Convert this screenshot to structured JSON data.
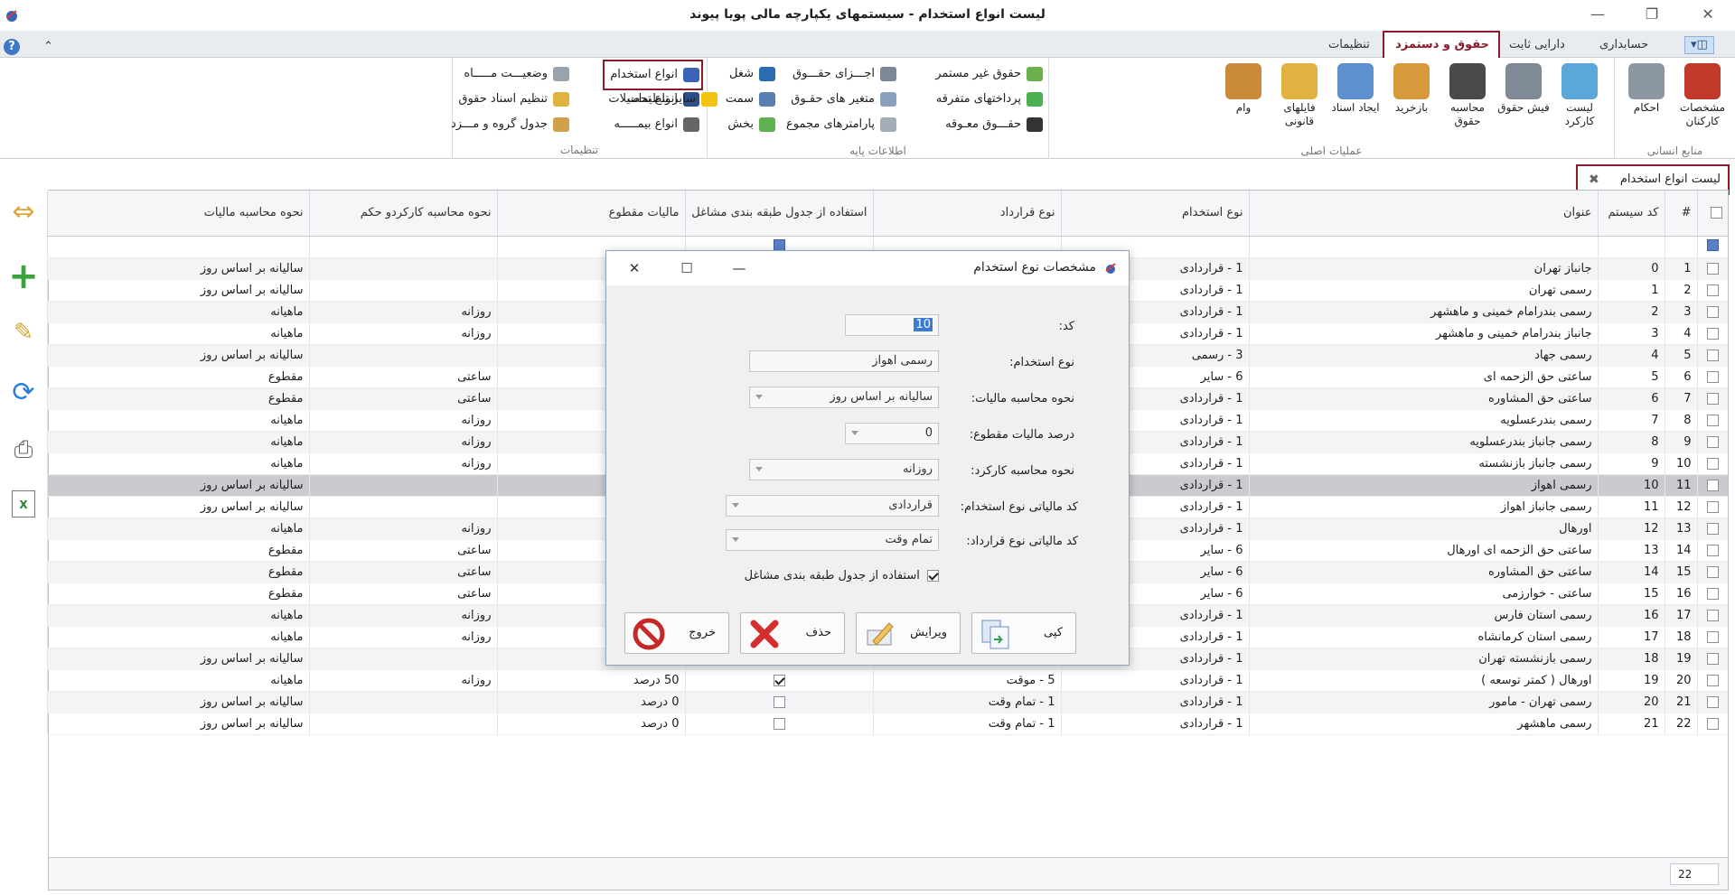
{
  "window": {
    "title": "لیست انواع استخدام - سیستمهای یکپارچه مالی پویا پیوند"
  },
  "tabs": {
    "accounting": "حسابداری",
    "fixed_assets": "دارایی ثابت",
    "payroll": "حقوق و دستمزد",
    "settings": "تنظیمات"
  },
  "ribbon": {
    "hr": {
      "label": "منابع انسانی",
      "employee_specs": "مشخصات کارکنان",
      "rulings": "احکام"
    },
    "main_ops": {
      "label": "عملیات اصلی",
      "work_list": "لیست کارکرد",
      "payslip": "فیش حقوق",
      "calc_salary": "محاسبه حقوق",
      "recalc": "بازخرید",
      "create_doc": "ایجاد اسناد",
      "legal_files": "فایلهای قانونی",
      "loan": "وام"
    },
    "base_info": {
      "label": "اطلاعات پایه",
      "irregular_salary": "حقوق غیر مستمر",
      "misc_payments": "پرداختهای متفرقه",
      "deferred_salary": "حقـــوق معـوقه",
      "salary_parts": "اجـــزای حقـــوق",
      "salary_vars": "متغیر های حقـوق",
      "total_params": "پارامترهای مجموع",
      "job": "شغل",
      "position": "سمت",
      "section": "بخش",
      "employment_types": "انواع استخدام",
      "education_types": "انواع تحصیلات",
      "insurance_types": "انواع بیمـــــه"
    },
    "settings": {
      "label": "تنظیمات",
      "month_status": "وضعیـــت مـــــاه",
      "salary_doc_setup": "تنظیم اسناد حقوق",
      "group_wage_table": "جدول گروه و مـــزد",
      "other_settings": "سایر تنظیمات"
    }
  },
  "doc_tab": {
    "label": "لیست انواع استخدام"
  },
  "grid": {
    "headers": [
      "#",
      "کد سیستم",
      "عنوان",
      "نوع استخدام",
      "نوع قرارداد",
      "استفاده از جدول طبقه بندی مشاغل",
      "مالیات مقطوع",
      "نحوه محاسبه کارکردو حکم",
      "نحوه محاسبه مالیات"
    ],
    "rows": [
      {
        "n": "1",
        "code": "0",
        "title": "جانباز تهران",
        "etype": "1 - قراردادی",
        "ctype": "",
        "cls": "",
        "tax": "",
        "work": "",
        "taxcalc": "سالیانه بر اساس روز"
      },
      {
        "n": "2",
        "code": "1",
        "title": "رسمی تهران",
        "etype": "1 - قراردادی",
        "ctype": "",
        "cls": "",
        "tax": "",
        "work": "",
        "taxcalc": "سالیانه بر اساس روز"
      },
      {
        "n": "3",
        "code": "2",
        "title": "رسمی بندرامام خمینی و ماهشهر",
        "etype": "1 - قراردادی",
        "ctype": "",
        "cls": "",
        "tax": "",
        "work": "روزانه",
        "taxcalc": "ماهیانه"
      },
      {
        "n": "4",
        "code": "3",
        "title": "جانباز بندرامام خمینی و ماهشهر",
        "etype": "1 - قراردادی",
        "ctype": "",
        "cls": "",
        "tax": "",
        "work": "روزانه",
        "taxcalc": "ماهیانه"
      },
      {
        "n": "5",
        "code": "4",
        "title": "رسمی جهاد",
        "etype": "3 - رسمی",
        "ctype": "",
        "cls": "",
        "tax": "",
        "work": "",
        "taxcalc": "سالیانه بر اساس روز"
      },
      {
        "n": "6",
        "code": "5",
        "title": "ساعتی حق الزحمه ای",
        "etype": "6 - سایر",
        "ctype": "",
        "cls": "",
        "tax": "",
        "work": "ساعتی",
        "taxcalc": "مقطوع"
      },
      {
        "n": "7",
        "code": "6",
        "title": "ساعتی حق المشاوره",
        "etype": "1 - قراردادی",
        "ctype": "",
        "cls": "",
        "tax": "",
        "work": "ساعتی",
        "taxcalc": "مقطوع"
      },
      {
        "n": "8",
        "code": "7",
        "title": "رسمی بندرعسلویه",
        "etype": "1 - قراردادی",
        "ctype": "",
        "cls": "",
        "tax": "",
        "work": "روزانه",
        "taxcalc": "ماهیانه"
      },
      {
        "n": "9",
        "code": "8",
        "title": "رسمی جانباز بندرعسلویه",
        "etype": "1 - قراردادی",
        "ctype": "",
        "cls": "",
        "tax": "",
        "work": "روزانه",
        "taxcalc": "ماهیانه"
      },
      {
        "n": "10",
        "code": "9",
        "title": "رسمی جانباز بازنشسته",
        "etype": "1 - قراردادی",
        "ctype": "",
        "cls": "",
        "tax": "",
        "work": "روزانه",
        "taxcalc": "ماهیانه"
      },
      {
        "n": "11",
        "code": "10",
        "title": "رسمی اهواز",
        "etype": "1 - قراردادی",
        "ctype": "",
        "cls": "",
        "tax": "",
        "work": "",
        "taxcalc": "سالیانه بر اساس روز"
      },
      {
        "n": "12",
        "code": "11",
        "title": "رسمی جانباز اهواز",
        "etype": "1 - قراردادی",
        "ctype": "",
        "cls": "",
        "tax": "",
        "work": "",
        "taxcalc": "سالیانه بر اساس روز"
      },
      {
        "n": "13",
        "code": "12",
        "title": "اورهال",
        "etype": "1 - قراردادی",
        "ctype": "",
        "cls": "",
        "tax": "",
        "work": "روزانه",
        "taxcalc": "ماهیانه"
      },
      {
        "n": "14",
        "code": "13",
        "title": "ساعتی حق الزحمه ای اورهال",
        "etype": "6 - سایر",
        "ctype": "",
        "cls": "",
        "tax": "",
        "work": "ساعتی",
        "taxcalc": "مقطوع"
      },
      {
        "n": "15",
        "code": "14",
        "title": "ساعتی حق المشاوره",
        "etype": "6 - سایر",
        "ctype": "",
        "cls": "",
        "tax": "",
        "work": "ساعتی",
        "taxcalc": "مقطوع"
      },
      {
        "n": "16",
        "code": "15",
        "title": "ساعتی - خوارزمی",
        "etype": "6 - سایر",
        "ctype": "",
        "cls": "",
        "tax": "",
        "work": "ساعتی",
        "taxcalc": "مقطوع"
      },
      {
        "n": "17",
        "code": "16",
        "title": "رسمی استان فارس",
        "etype": "1 - قراردادی",
        "ctype": "",
        "cls": "",
        "tax": "",
        "work": "روزانه",
        "taxcalc": "ماهیانه"
      },
      {
        "n": "18",
        "code": "17",
        "title": "رسمی استان کرمانشاه",
        "etype": "1 - قراردادی",
        "ctype": "",
        "cls": "",
        "tax": "",
        "work": "روزانه",
        "taxcalc": "ماهیانه"
      },
      {
        "n": "19",
        "code": "18",
        "title": "رسمی بازنشسته تهران",
        "etype": "1 - قراردادی",
        "ctype": "",
        "cls": "",
        "tax": "",
        "work": "",
        "taxcalc": "سالیانه بر اساس روز"
      },
      {
        "n": "20",
        "code": "19",
        "title": "اورهال ( کمتر توسعه )",
        "etype": "1 - قراردادی",
        "ctype": "5 - موقت",
        "cls": "on",
        "tax": "50 درصد",
        "work": "روزانه",
        "taxcalc": "ماهیانه"
      },
      {
        "n": "21",
        "code": "20",
        "title": "رسمی تهران - مامور",
        "etype": "1 - قراردادی",
        "ctype": "1 - تمام وقت",
        "cls": "off",
        "tax": "0 درصد",
        "work": "",
        "taxcalc": "سالیانه بر اساس روز"
      },
      {
        "n": "22",
        "code": "21",
        "title": "رسمی ماهشهر",
        "etype": "1 - قراردادی",
        "ctype": "1 - تمام وقت",
        "cls": "off",
        "tax": "0 درصد",
        "work": "",
        "taxcalc": "سالیانه بر اساس روز"
      }
    ],
    "selected_row": 11,
    "footer_count": "22"
  },
  "dialog": {
    "title": "مشخصات نوع استخدام",
    "labels": {
      "code": "کد:",
      "etype": "نوع استخدام:",
      "taxcalc": "نحوه محاسبه مالیات:",
      "taxpct": "درصد مالیات مقطوع:",
      "workcalc": "نحوه محاسبه کارکرد:",
      "tax_etype": "کد مالیاتی نوع استخدام:",
      "tax_ctype": "کد مالیاتی نوع قرارداد:"
    },
    "values": {
      "code": "10",
      "etype": "رسمی اهواز",
      "taxcalc": "سالیانه بر اساس روز",
      "taxpct": "0",
      "workcalc": "روزانه",
      "tax_etype": "قراردادی",
      "tax_ctype": "تمام وقت"
    },
    "use_classification": "استفاده از جدول طبقه بندی مشاغل",
    "buttons": {
      "copy": "کپی",
      "edit": "ویرایش",
      "delete": "حذف",
      "exit": "خروج"
    }
  },
  "colors": {
    "accent": "#8b1a2b",
    "selected_row": "#c9cbcf"
  }
}
